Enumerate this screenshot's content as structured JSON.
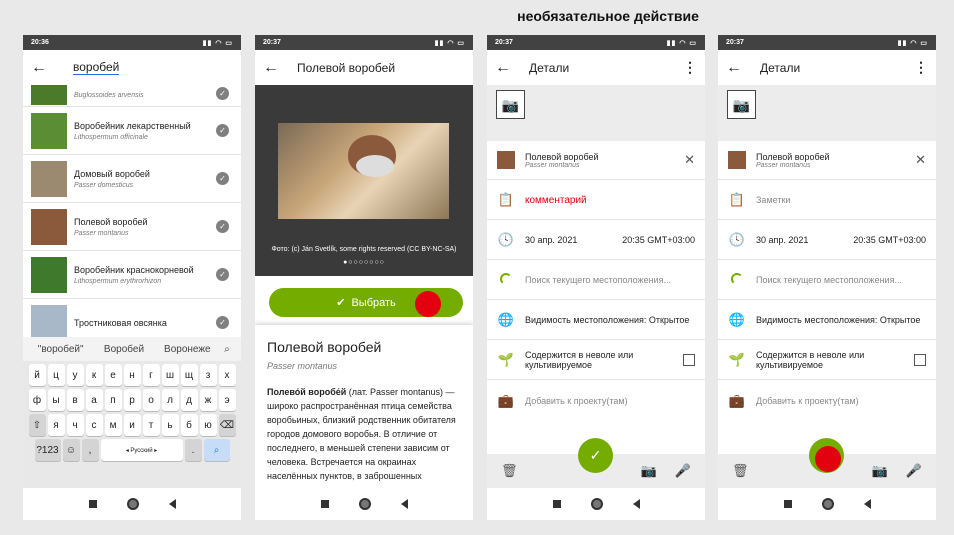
{
  "caption": "необязательное действие",
  "phones": [
    {
      "time": "20:36",
      "status_icons": "▮▮ ◠ ▭",
      "search_query": "воробей",
      "items": [
        {
          "name": "",
          "latin": "Buglossoides arvensis"
        },
        {
          "name": "Воробейник лекарственный",
          "latin": "Lithospermum officinale"
        },
        {
          "name": "Домовый воробей",
          "latin": "Passer domesticus"
        },
        {
          "name": "Полевой воробей",
          "latin": "Passer montanus"
        },
        {
          "name": "Воробейник краснокорневой",
          "latin": "Lithospermum erythrorhizon"
        },
        {
          "name": "Тростниковая овсянка",
          "latin": ""
        }
      ],
      "suggestions": [
        "\"воробей\"",
        "Воробей",
        "Воронеже"
      ],
      "keyboard": {
        "row1": [
          "й",
          "ц",
          "у",
          "к",
          "е",
          "н",
          "г",
          "ш",
          "щ",
          "з",
          "х"
        ],
        "row2": [
          "ф",
          "ы",
          "в",
          "а",
          "п",
          "р",
          "о",
          "л",
          "д",
          "ж",
          "э"
        ],
        "row3": [
          "я",
          "ч",
          "с",
          "м",
          "и",
          "т",
          "ь",
          "б",
          "ю"
        ],
        "num": "?123",
        "lang": "◂ Русский ▸",
        "dot": "."
      }
    },
    {
      "time": "20:37",
      "title": "Полевой воробей",
      "photo_credit": "Фото: (c) Ján Svetlík, some rights reserved (CC BY-NC-SA)",
      "dots": "●○○○○○○○",
      "select_label": "Выбрать",
      "desc_title": "Полевой воробей",
      "desc_latin": "Passer montanus",
      "desc_bold": "Полево́й воробе́й",
      "desc_body": " (лат. Passer montanus) — широко распространённая птица семейства воробьиных, близкий родственник обитателя городов домового воробья. В отличие от последнего, в меньшей степени зависим от человека. Встречается на окраинах населённых пунктов, в заброшенных"
    },
    {
      "time": "20:37",
      "title": "Детали",
      "taxon": "Полевой воробей",
      "taxon_latin": "Passer montanus",
      "notes": "комментарий",
      "date": "30 апр. 2021",
      "time_tz": "20:35 GMT+03:00",
      "location": "Поиск текущего местоположения...",
      "visibility": "Видимость местоположения: Открытое",
      "captive": "Содержится в неволе или культивируемое",
      "project": "Добавить к проекту(там)"
    },
    {
      "time": "20:37",
      "title": "Детали",
      "taxon": "Полевой воробей",
      "taxon_latin": "Passer montanus",
      "notes": "Заметки",
      "date": "30 апр. 2021",
      "time_tz": "20:35 GMT+03:00",
      "location": "Поиск текущего местоположения...",
      "visibility": "Видимость местоположения: Открытое",
      "captive": "Содержится в неволе или культивируемое",
      "project": "Добавить к проекту(там)"
    }
  ],
  "colors": {
    "accent": "#74ac00",
    "marker": "#e3000f"
  }
}
